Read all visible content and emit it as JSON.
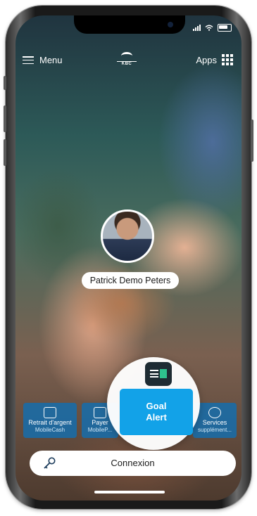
{
  "header": {
    "menu_label": "Menu",
    "logo_text": "KBC",
    "apps_label": "Apps"
  },
  "profile": {
    "name": "Patrick Demo Peters"
  },
  "quick_actions": [
    {
      "label": "Retrait d'argent",
      "sublabel": "MobileCash",
      "icon": "atm-icon"
    },
    {
      "label": "Payer",
      "sublabel": "MobileP...",
      "icon": "qr-icon"
    },
    {
      "label": "Services",
      "sublabel": "supplément...",
      "icon": "services-icon"
    }
  ],
  "goal_alert": {
    "label_line1": "Goal",
    "label_line2": "Alert",
    "icon": "goal-alert-icon"
  },
  "login": {
    "label": "Connexion",
    "icon": "key-icon"
  },
  "colors": {
    "tile_blue": "#186CA8",
    "goal_blue": "#12A2E8",
    "goal_green": "#2EC18E"
  }
}
